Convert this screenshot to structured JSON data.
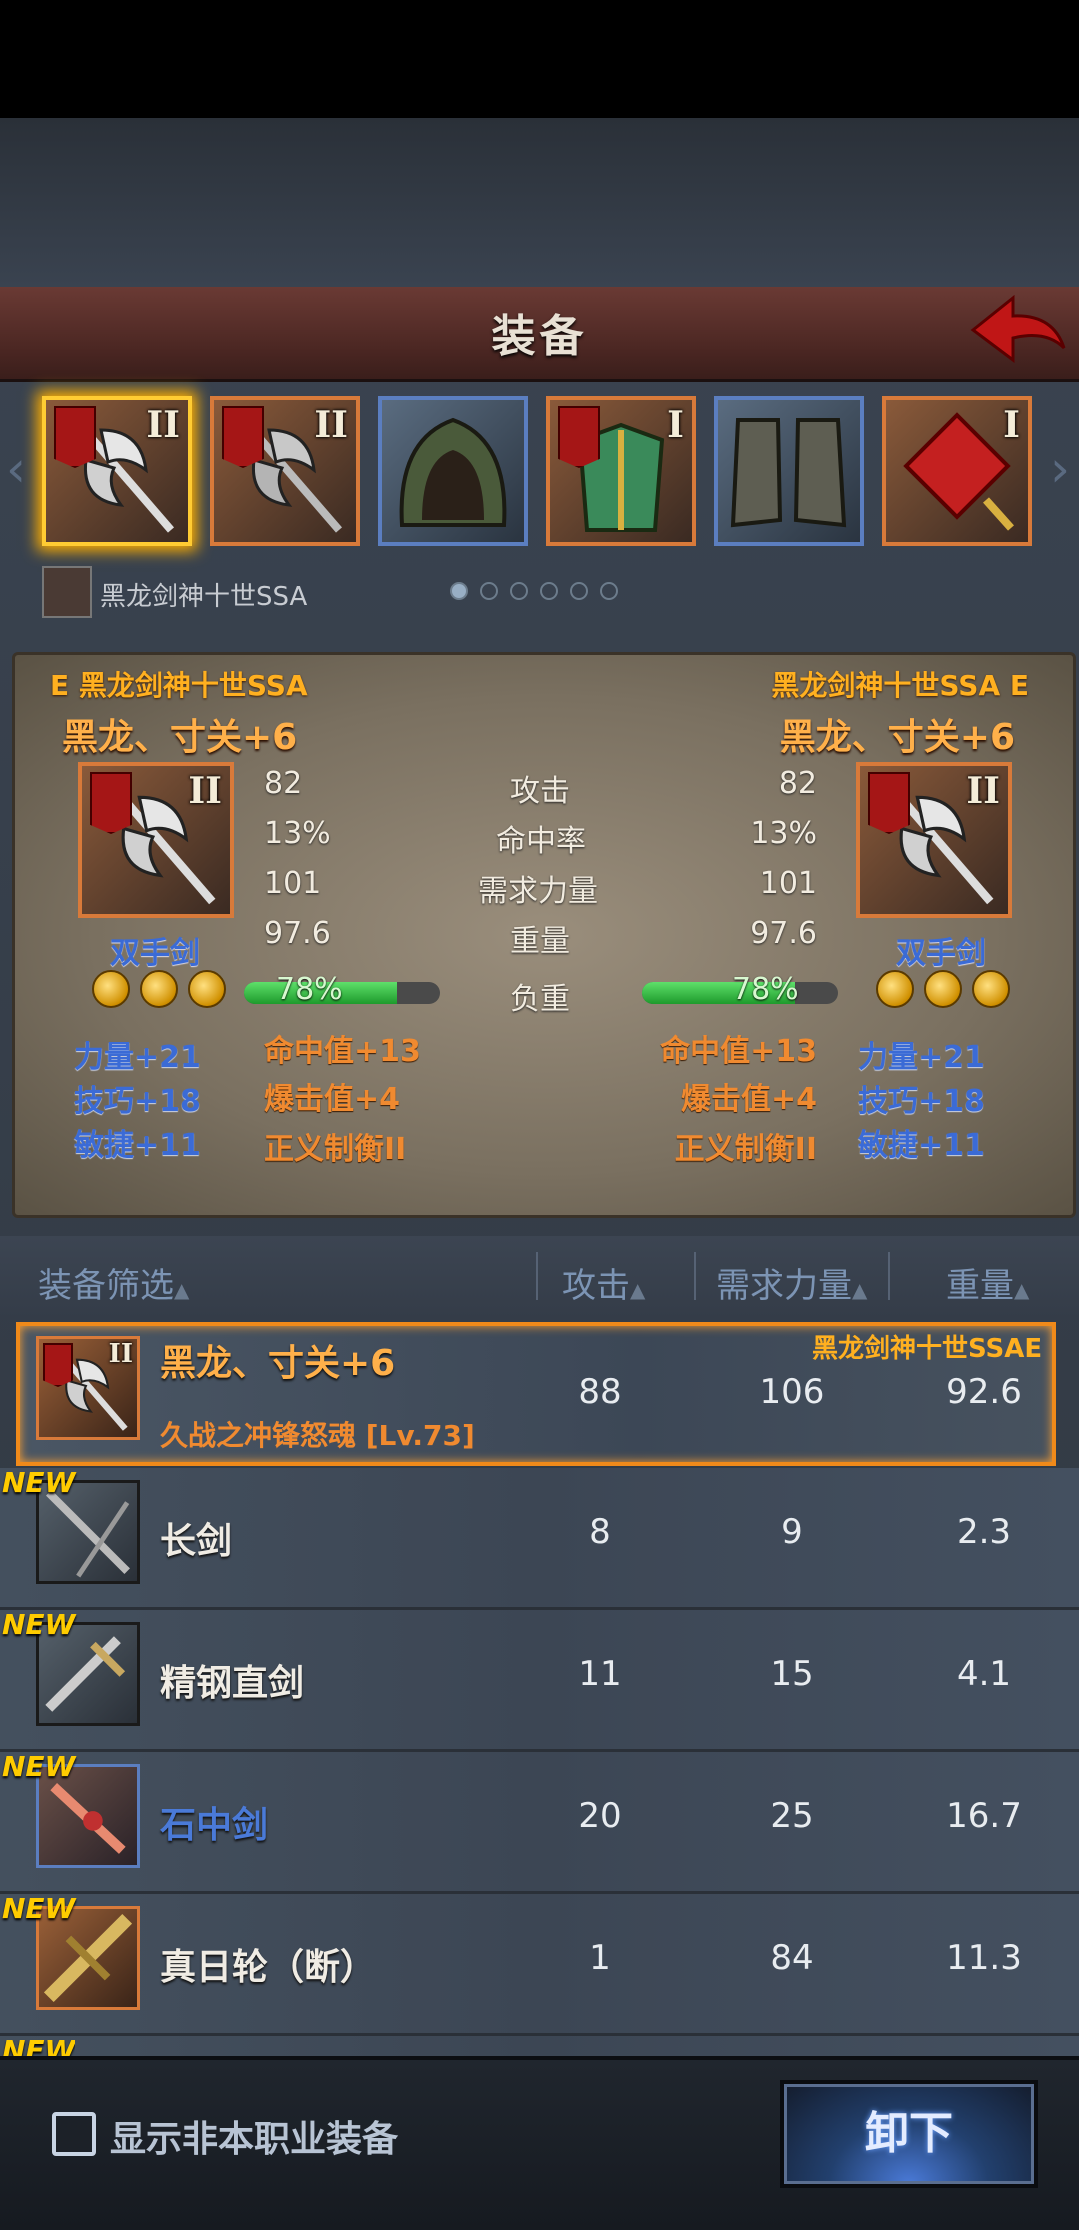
{
  "header": {
    "title": "装备"
  },
  "slots": [
    {
      "roman": "II",
      "icon": "halberd-icon",
      "selected": true
    },
    {
      "roman": "II",
      "icon": "halberd-icon"
    },
    {
      "roman": "",
      "icon": "hood-icon"
    },
    {
      "roman": "I",
      "icon": "armor-icon"
    },
    {
      "roman": "",
      "icon": "boots-icon"
    },
    {
      "roman": "I",
      "icon": "knot-charm-icon"
    }
  ],
  "character": {
    "name": "黑龙剑神十世SSA",
    "page_count": 6,
    "current_page": 1
  },
  "compare": {
    "left": {
      "owner": "E 黑龙剑神十世SSA",
      "item_name": "黑龙、寸关+6",
      "roman": "II",
      "type": "双手剑",
      "stats": [
        "82",
        "13%",
        "101",
        "97.6"
      ],
      "load": "78%",
      "load_fraction": 0.78,
      "attrs": [
        "力量+21",
        "技巧+18",
        "敏捷+11"
      ],
      "bonuses": [
        "命中值+13",
        "爆击值+4",
        "正义制衡II"
      ]
    },
    "right": {
      "owner": "黑龙剑神十世SSA E",
      "item_name": "黑龙、寸关+6",
      "roman": "II",
      "type": "双手剑",
      "stats": [
        "82",
        "13%",
        "101",
        "97.6"
      ],
      "load": "78%",
      "load_fraction": 0.78,
      "attrs": [
        "力量+21",
        "技巧+18",
        "敏捷+11"
      ],
      "bonuses": [
        "命中值+13",
        "爆击值+4",
        "正义制衡II"
      ]
    },
    "stat_labels": [
      "攻击",
      "命中率",
      "需求力量",
      "重量",
      "负重"
    ]
  },
  "list": {
    "filter_label": "装备筛选",
    "columns": [
      "攻击",
      "需求力量",
      "重量"
    ],
    "sort_arrow": "▲",
    "new_badge": "NEW",
    "items": [
      {
        "name": "黑龙、寸关+6",
        "subtitle": "久战之冲锋怒魂 [Lv.73]",
        "owner": "黑龙剑神十世SSAE",
        "roman": "II",
        "atk": "88",
        "str": "106",
        "weight": "92.6",
        "is_new": false,
        "selected": true,
        "icon": "halberd-icon"
      },
      {
        "name": "长剑",
        "atk": "8",
        "str": "9",
        "weight": "2.3",
        "is_new": true,
        "icon": "long-sword-icon"
      },
      {
        "name": "精钢直剑",
        "atk": "11",
        "str": "15",
        "weight": "4.1",
        "is_new": true,
        "icon": "steel-sword-icon"
      },
      {
        "name": "石中剑",
        "atk": "20",
        "str": "25",
        "weight": "16.7",
        "is_new": true,
        "icon": "stone-sword-icon"
      },
      {
        "name": "真日轮（断）",
        "atk": "1",
        "str": "84",
        "weight": "11.3",
        "is_new": true,
        "icon": "sun-wheel-icon"
      }
    ]
  },
  "footer": {
    "checkbox_label": "显示非本职业装备",
    "checked": false,
    "unequip_label": "卸下"
  },
  "colors": {
    "accent_orange": "#f08a1a",
    "gold": "#ffb020",
    "blue_attr": "#3b6bd6",
    "bonus_orange": "#f08a30"
  }
}
